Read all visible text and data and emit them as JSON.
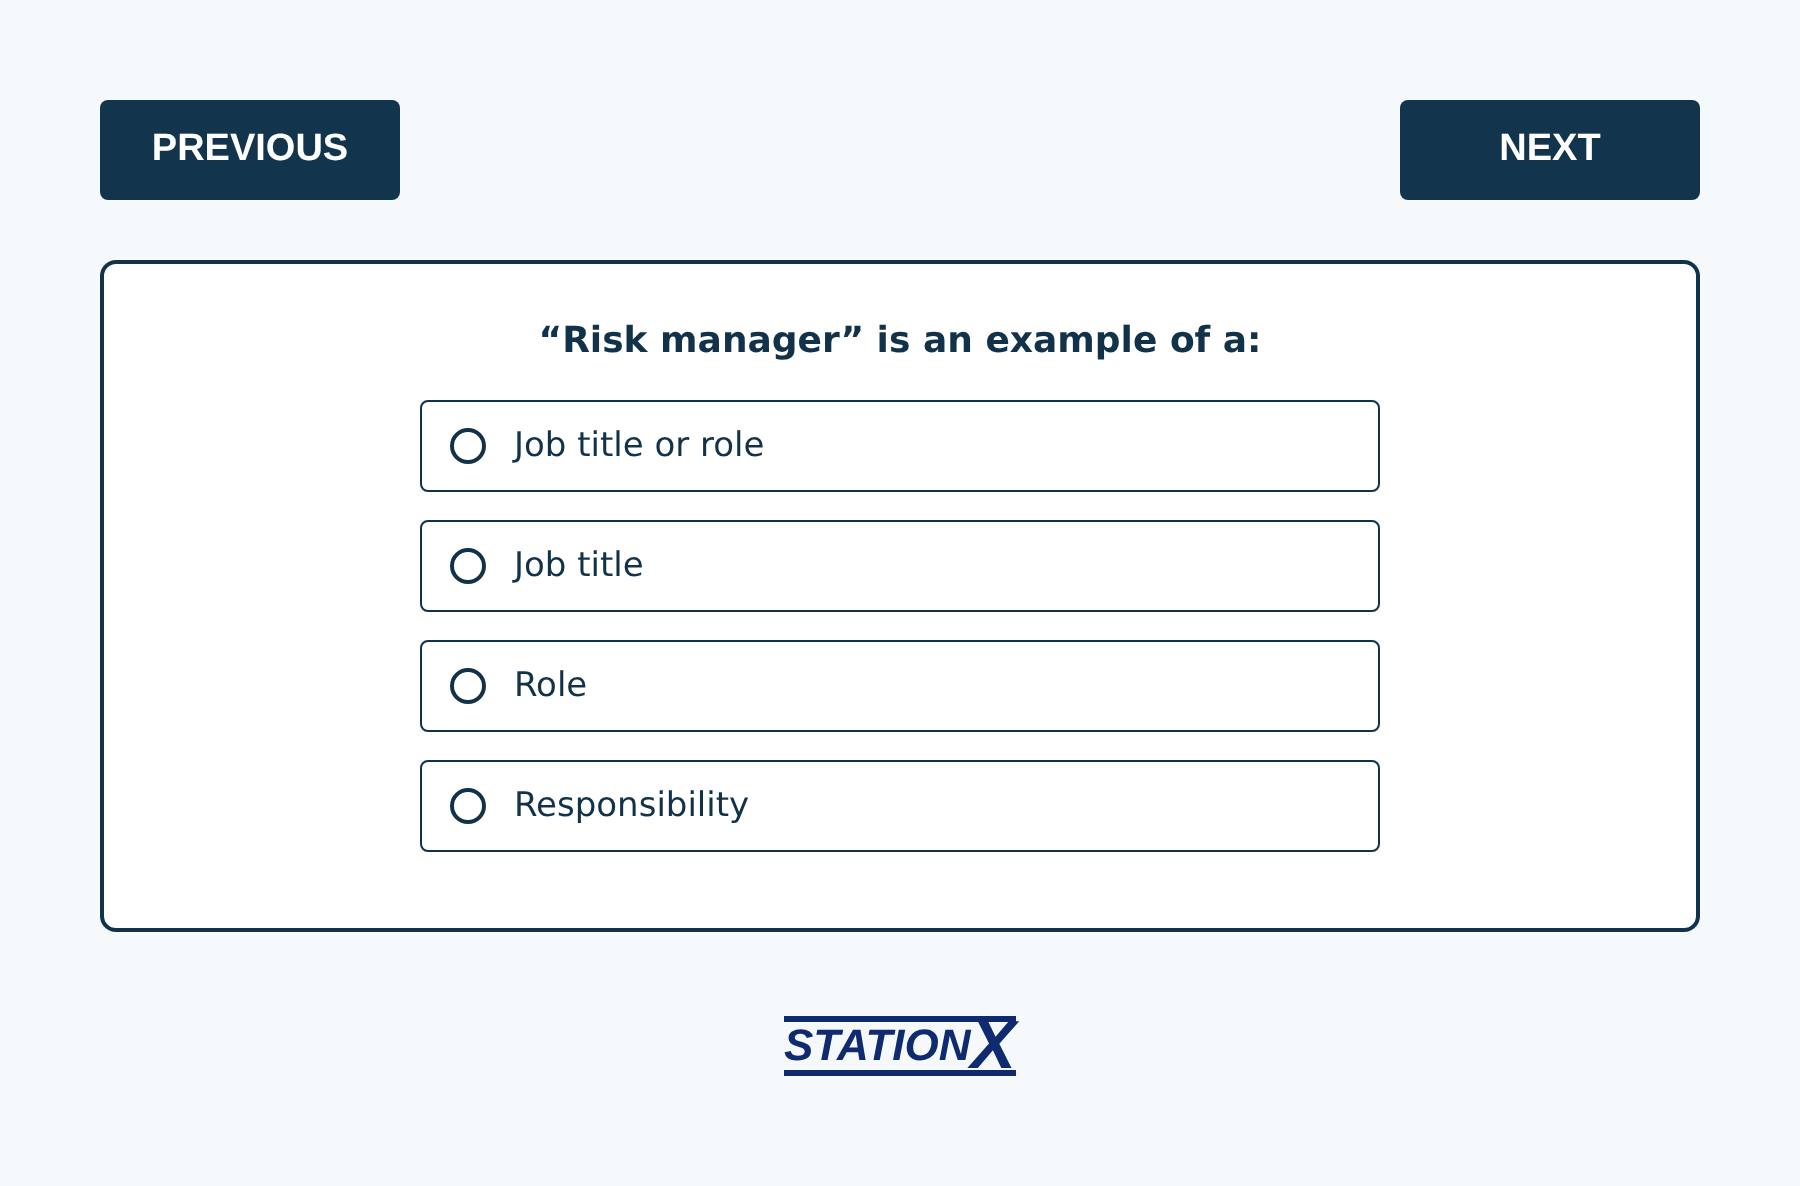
{
  "nav": {
    "previous": "PREVIOUS",
    "next": "NEXT"
  },
  "question": "“Risk manager” is an example of a:",
  "options": [
    {
      "label": "Job title or role",
      "selected": false
    },
    {
      "label": "Job title",
      "selected": false
    },
    {
      "label": "Role",
      "selected": false
    },
    {
      "label": "Responsibility",
      "selected": false
    }
  ],
  "logo": {
    "text": "STATION",
    "mark": "X"
  }
}
